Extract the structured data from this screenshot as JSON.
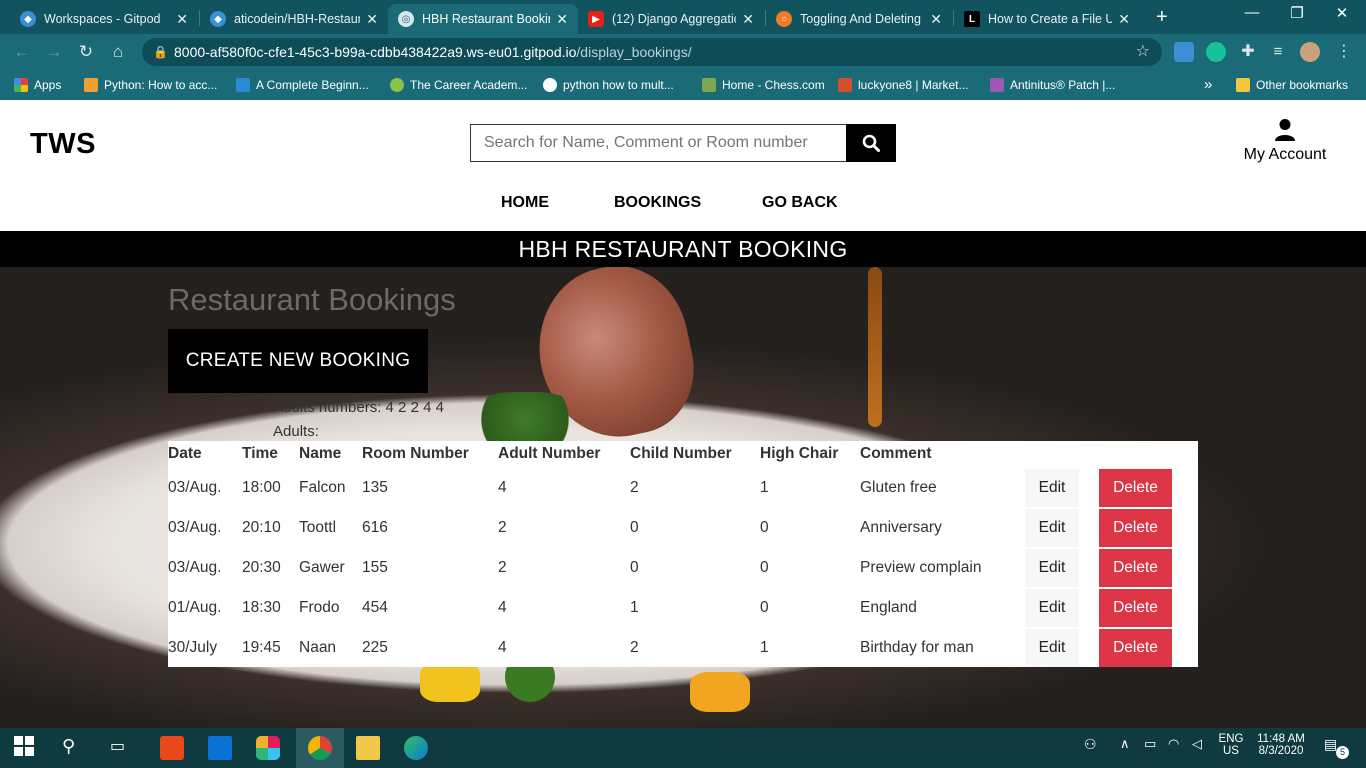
{
  "browser": {
    "tabs": [
      {
        "label": "Workspaces - Gitpod",
        "icon": "gitpod-icon",
        "active": false
      },
      {
        "label": "aticodein/HBH-Restaura",
        "icon": "gitpod-icon",
        "active": false
      },
      {
        "label": "HBH Restaurant Bookin",
        "icon": "globe-icon",
        "active": true
      },
      {
        "label": "(12) Django Aggregatio",
        "icon": "youtube-icon",
        "active": false
      },
      {
        "label": "Toggling And Deleting",
        "icon": "circle-icon",
        "active": false
      },
      {
        "label": "How to Create a File Up",
        "icon": "l-logo-icon",
        "active": false
      }
    ],
    "new_tab": "+",
    "url_host": "8000-af580f0c-cfe1-45c3-b99a-cdbb438422a9.ws-eu01.gitpod.io",
    "url_path": "/display_bookings/",
    "bookmarks": [
      {
        "label": "Apps",
        "color": "#e0413a"
      },
      {
        "label": "Python: How to acc...",
        "color": "#f0a030"
      },
      {
        "label": "A Complete Beginn...",
        "color": "#2a8ad6"
      },
      {
        "label": "The Career Academ...",
        "color": "#8bc34a"
      },
      {
        "label": "python how to mult...",
        "color": "#ffffff"
      },
      {
        "label": "Home - Chess.com",
        "color": "#7fa650"
      },
      {
        "label": "luckyone8 | Market...",
        "color": "#d05030"
      },
      {
        "label": "Antinitus® Patch |...",
        "color": "#9b59b6"
      }
    ],
    "more_bookmarks": "»",
    "other_bookmarks": "Other bookmarks"
  },
  "site": {
    "logo": "TWS",
    "search_placeholder": "Search for Name, Comment or Room number",
    "account_label": "My Account",
    "nav": [
      "HOME",
      "BOOKINGS",
      "GO BACK"
    ],
    "banner": "HBH RESTAURANT BOOKING"
  },
  "main": {
    "title": "Restaurant Bookings",
    "create_button": "CREATE NEW BOOKING",
    "adults_numbers": "Adults numbers: 4 2 2 4 4",
    "adults": "Adults:"
  },
  "table": {
    "headers": [
      "Date",
      "Time",
      "Name",
      "Room Number",
      "Adult Number",
      "Child Number",
      "High Chair",
      "Comment"
    ],
    "edit_label": "Edit",
    "delete_label": "Delete",
    "rows": [
      [
        "03/Aug.",
        "18:00",
        "Falcon",
        "135",
        "4",
        "2",
        "1",
        "Gluten free"
      ],
      [
        "03/Aug.",
        "20:10",
        "Toottl",
        "616",
        "2",
        "0",
        "0",
        "Anniversary"
      ],
      [
        "03/Aug.",
        "20:30",
        "Gawer",
        "155",
        "2",
        "0",
        "0",
        "Preview complain"
      ],
      [
        "01/Aug.",
        "18:30",
        "Frodo",
        "454",
        "4",
        "1",
        "0",
        "England"
      ],
      [
        "30/July",
        "19:45",
        "Naan",
        "225",
        "4",
        "2",
        "1",
        "Birthday for man"
      ]
    ]
  },
  "taskbar": {
    "language": "ENG",
    "region": "US",
    "time": "11:48 AM",
    "date": "8/3/2020",
    "notifications": "5"
  },
  "colors": {
    "chrome": "#11535f",
    "toolbar": "#1a6a78",
    "delete": "#dc3545",
    "banner": "#000000"
  }
}
